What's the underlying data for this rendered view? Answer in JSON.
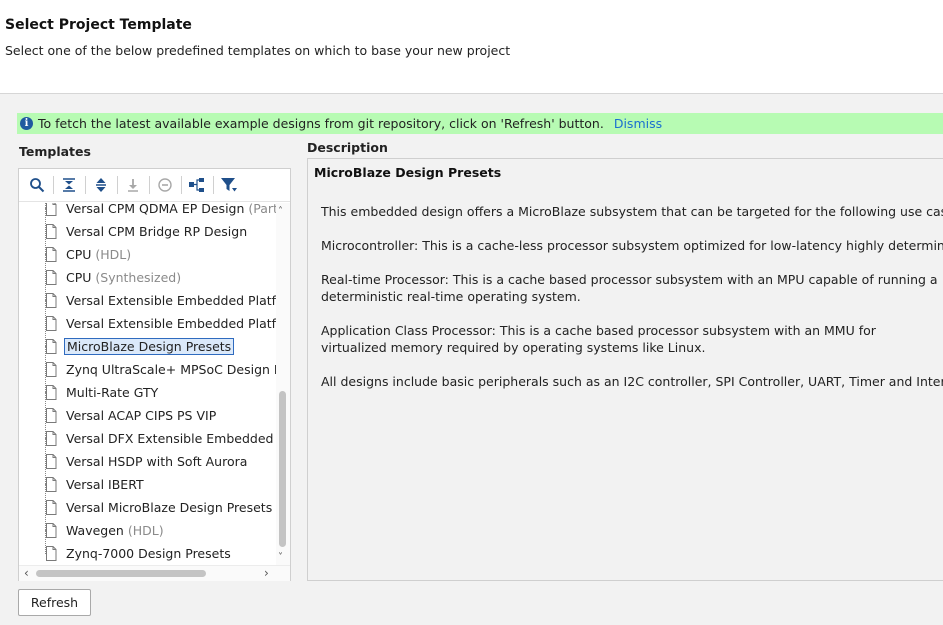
{
  "header": {
    "title": "Select Project Template",
    "subtitle": "Select one of the below predefined templates on which to base your new project"
  },
  "banner": {
    "text": "To fetch the latest available example designs from git repository, click on 'Refresh' button.",
    "dismiss_label": "Dismiss"
  },
  "templates": {
    "label": "Templates",
    "toolbar": [
      "search-icon",
      "collapse-all-icon",
      "expand-all-icon",
      "download-icon",
      "remove-icon",
      "hierarchy-icon",
      "filter-icon"
    ],
    "items": [
      {
        "label": "Versal CPM QDMA EP Design",
        "suffix": " (Part ba"
      },
      {
        "label": "Versal CPM Bridge RP Design",
        "suffix": ""
      },
      {
        "label": "CPU",
        "suffix": " (HDL)"
      },
      {
        "label": "CPU",
        "suffix": " (Synthesized)"
      },
      {
        "label": "Versal Extensible Embedded Platform",
        "suffix": ""
      },
      {
        "label": "Versal Extensible Embedded Platform",
        "suffix": ""
      },
      {
        "label": "MicroBlaze Design Presets",
        "suffix": "",
        "selected": true
      },
      {
        "label": "Zynq UltraScale+ MPSoC Design Pres",
        "suffix": ""
      },
      {
        "label": "Multi-Rate GTY",
        "suffix": ""
      },
      {
        "label": "Versal ACAP CIPS PS VIP",
        "suffix": ""
      },
      {
        "label": "Versal DFX Extensible Embedded Platf",
        "suffix": ""
      },
      {
        "label": "Versal HSDP with Soft Aurora",
        "suffix": ""
      },
      {
        "label": "Versal IBERT",
        "suffix": ""
      },
      {
        "label": "Versal MicroBlaze Design Presets",
        "suffix": ""
      },
      {
        "label": "Wavegen",
        "suffix": " (HDL)"
      },
      {
        "label": "Zynq-7000 Design Presets",
        "suffix": ""
      }
    ]
  },
  "description": {
    "label": "Description",
    "title": "MicroBlaze Design Presets",
    "paragraphs": [
      "This embedded design offers a MicroBlaze subsystem that can be targeted for the following use cases.",
      "Microcontroller: This is a cache-less processor subsystem optimized for low-latency highly deterministic operatio",
      "Real-time Processor: This is a cache based processor subsystem with an MPU capable of running a deterministic real-time operating system.",
      "Application Class Processor: This is a cache based processor subsystem with an MMU for virtualized memory required by operating systems like Linux.",
      "All designs include basic peripherals such as an I2C controller, SPI Controller, UART, Timer and Interrupt Control"
    ]
  },
  "refresh_label": "Refresh",
  "colors": {
    "banner": "#b7fbb3",
    "link": "#1a6fd0",
    "selection_border": "#2f6bbf",
    "selection_fill": "#dbe9fa"
  }
}
